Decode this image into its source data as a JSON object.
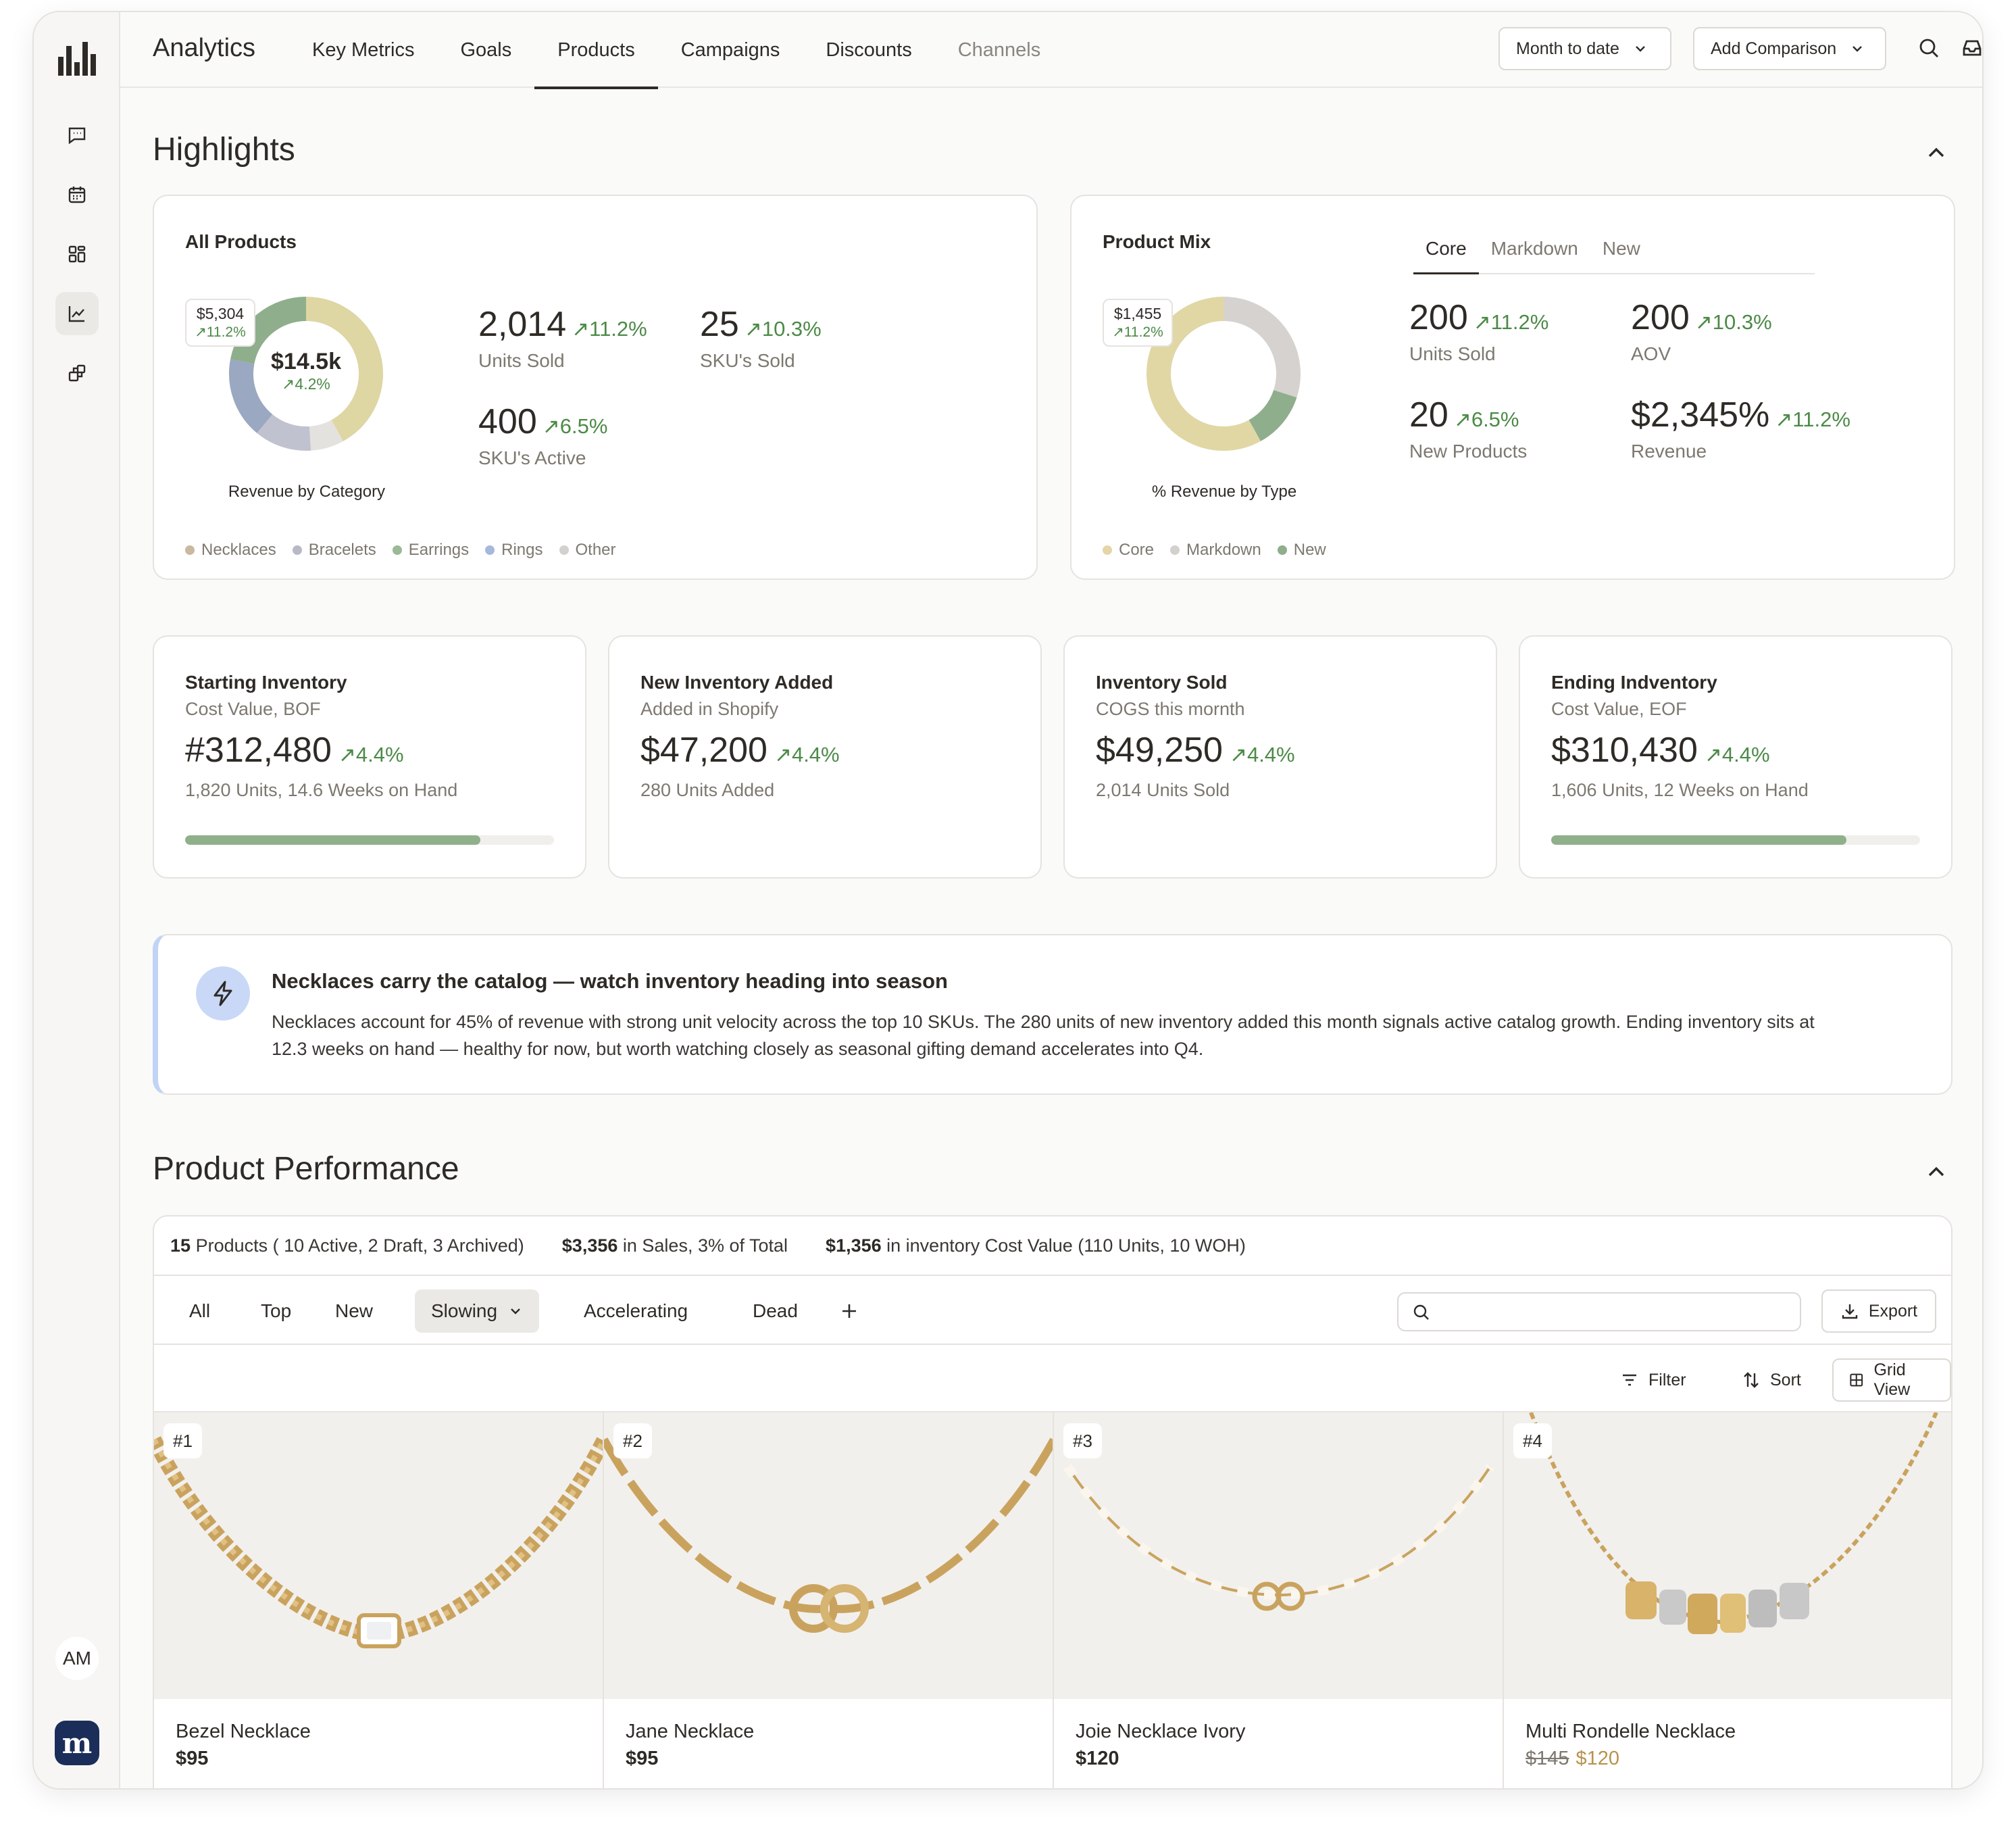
{
  "app": {
    "title": "Analytics"
  },
  "nav": [
    {
      "label": "Key Metrics",
      "active": false
    },
    {
      "label": "Goals",
      "active": false
    },
    {
      "label": "Products",
      "active": true
    },
    {
      "label": "Campaigns",
      "active": false
    },
    {
      "label": "Discounts",
      "active": false
    },
    {
      "label": "Channels",
      "active": false,
      "dim": true
    }
  ],
  "toolbar": {
    "date_range": "Month to date",
    "comparison": "Add Comparison"
  },
  "user": {
    "initials": "AM",
    "brand_letter": "m"
  },
  "highlights": {
    "title": "Highlights",
    "all_products": {
      "title": "All Products",
      "donut_center_value": "$14.5k",
      "donut_center_change": "4.2%",
      "donut_badge_value": "$5,304",
      "donut_badge_change": "11.2%",
      "donut_caption": "Revenue by Category",
      "donut_segments": [
        {
          "name": "Necklaces",
          "fraction": 0.42,
          "color": "#ded6a3"
        },
        {
          "name": "Other",
          "fraction": 0.07,
          "color": "#e4e2de"
        },
        {
          "name": "Bracelets",
          "fraction": 0.12,
          "color": "#c0c2cf"
        },
        {
          "name": "Rings",
          "fraction": 0.17,
          "color": "#9aa8c1"
        },
        {
          "name": "Earrings",
          "fraction": 0.22,
          "color": "#8fae8c"
        }
      ],
      "metrics": [
        {
          "value": "2,014",
          "change": "11.2%",
          "label": "Units Sold"
        },
        {
          "value": "25",
          "change": "10.3%",
          "label": "SKU's Sold"
        },
        {
          "value": "400",
          "change": "6.5%",
          "label": "SKU's Active"
        }
      ],
      "legend": [
        {
          "label": "Necklaces",
          "color": "#c9b9a0"
        },
        {
          "label": "Bracelets",
          "color": "#b8b9c7"
        },
        {
          "label": "Earrings",
          "color": "#9bb897"
        },
        {
          "label": "Rings",
          "color": "#a6b8dd"
        },
        {
          "label": "Other",
          "color": "#d3d1cd"
        }
      ]
    },
    "product_mix": {
      "title": "Product Mix",
      "tabs": [
        {
          "label": "Core",
          "active": true
        },
        {
          "label": "Markdown",
          "active": false
        },
        {
          "label": "New",
          "active": false
        }
      ],
      "donut_badge_value": "$1,455",
      "donut_badge_change": "11.2%",
      "donut_caption": "% Revenue by Type",
      "donut_segments": [
        {
          "name": "Markdown",
          "fraction": 0.3,
          "color": "#d6d2cf"
        },
        {
          "name": "New",
          "fraction": 0.12,
          "color": "#8fae8c"
        },
        {
          "name": "Core",
          "fraction": 0.58,
          "color": "#e0d7a5"
        }
      ],
      "metrics": [
        {
          "value": "200",
          "change": "11.2%",
          "label": "Units Sold"
        },
        {
          "value": "200",
          "change": "10.3%",
          "label": "AOV"
        },
        {
          "value": "20",
          "change": "6.5%",
          "label": "New Products"
        },
        {
          "value": "$2,345%",
          "change": "11.2%",
          "label": "Revenue"
        }
      ],
      "legend": [
        {
          "label": "Core",
          "color": "#e6d5a8"
        },
        {
          "label": "Markdown",
          "color": "#d3d1cd"
        },
        {
          "label": "New",
          "color": "#8fae8c"
        }
      ]
    }
  },
  "inventory": [
    {
      "title": "Starting Inventory",
      "subtitle": "Cost Value, BOF",
      "value": "#312,480",
      "change": "4.4%",
      "note": "1,820 Units, 14.6 Weeks on Hand",
      "progress": 0.8
    },
    {
      "title": "New Inventory Added",
      "subtitle": "Added in Shopify",
      "value": "$47,200",
      "change": "4.4%",
      "note": "280 Units Added",
      "progress": null
    },
    {
      "title": "Inventory Sold",
      "subtitle": "COGS this mornth",
      "value": "$49,250",
      "change": "4.4%",
      "note": "2,014 Units Sold",
      "progress": null
    },
    {
      "title": "Ending Indventory",
      "subtitle": "Cost Value, EOF",
      "value": "$310,430",
      "change": "4.4%",
      "note": "1,606 Units, 12 Weeks on Hand",
      "progress": 0.8
    }
  ],
  "insight": {
    "title": "Necklaces carry the catalog — watch inventory heading into season",
    "body": "Necklaces account for 45% of revenue with strong unit velocity across the top 10 SKUs. The 280 units of new inventory added this month signals active catalog growth. Ending inventory sits at 12.3 weeks on hand — healthy for now, but worth watching closely as seasonal gifting demand accelerates into Q4."
  },
  "performance": {
    "title": "Product Performance",
    "summary": {
      "products_count": "15",
      "products_text": "Products  ( 10 Active, 2 Draft, 3 Archived)",
      "sales_value": "$3,356",
      "sales_text": "in Sales, 3% of Total",
      "inventory_value": "$1,356",
      "inventory_text": "in inventory Cost Value  (110 Units, 10 WOH)"
    },
    "filters": [
      {
        "label": "All",
        "active": false
      },
      {
        "label": "Top",
        "active": false
      },
      {
        "label": "New",
        "active": false
      },
      {
        "label": "Slowing",
        "active": true
      },
      {
        "label": "Accelerating",
        "active": false
      },
      {
        "label": "Dead",
        "active": false
      }
    ],
    "search_placeholder": "",
    "export_label": "Export",
    "filter_label": "Filter",
    "sort_label": "Sort",
    "view_label": "Grid View",
    "products": [
      {
        "rank": "#1",
        "name": "Bezel Necklace",
        "price": "$95",
        "original_price": null
      },
      {
        "rank": "#2",
        "name": "Jane Necklace",
        "price": "$95",
        "original_price": null
      },
      {
        "rank": "#3",
        "name": "Joie Necklace Ivory",
        "price": "$120",
        "original_price": null
      },
      {
        "rank": "#4",
        "name": "Multi Rondelle Necklace",
        "price": "$120",
        "original_price": "$145"
      }
    ]
  }
}
